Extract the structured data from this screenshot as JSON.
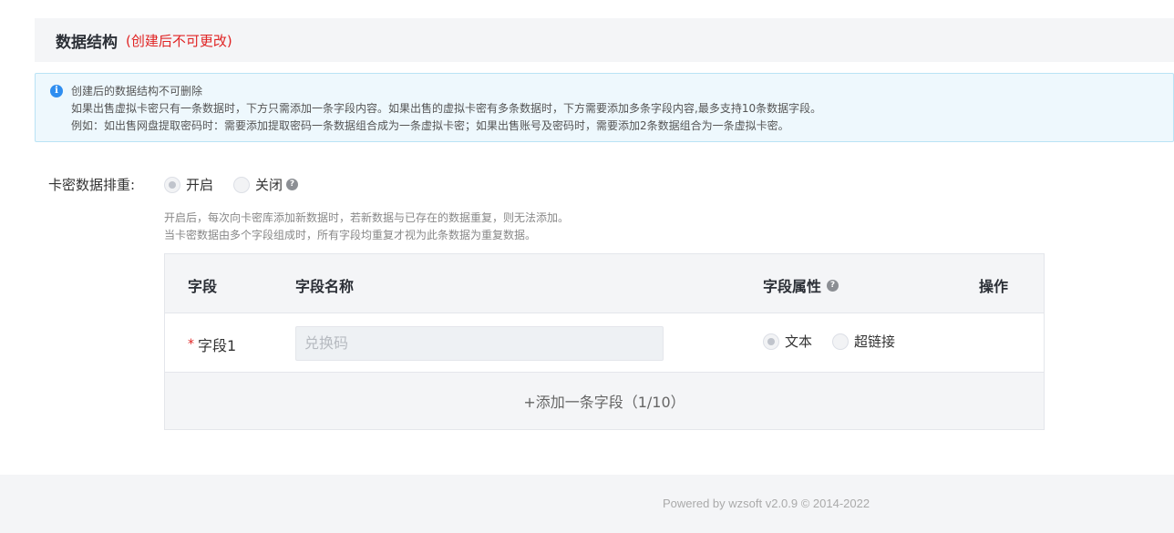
{
  "section": {
    "title": "数据结构",
    "note": "(创建后不可更改)"
  },
  "alert": {
    "icon": "info-icon",
    "line1": "创建后的数据结构不可删除",
    "line2": "如果出售虚拟卡密只有一条数据时，下方只需添加一条字段内容。如果出售的虚拟卡密有多条数据时，下方需要添加多条字段内容,最多支持10条数据字段。",
    "line3": "例如：如出售网盘提取密码时：需要添加提取密码一条数据组合成为一条虚拟卡密；如果出售账号及密码时，需要添加2条数据组合为一条虚拟卡密。"
  },
  "dedup": {
    "label": "卡密数据排重:",
    "options": [
      {
        "label": "开启",
        "selected": true
      },
      {
        "label": "关闭",
        "selected": false
      }
    ],
    "hint1": "开启后，每次向卡密库添加新数据时，若新数据与已存在的数据重复，则无法添加。",
    "hint2": "当卡密数据由多个字段组成时，所有字段均重复才视为此条数据为重复数据。"
  },
  "table": {
    "headers": {
      "field": "字段",
      "field_name": "字段名称",
      "field_attr": "字段属性",
      "action": "操作"
    },
    "rows": [
      {
        "required_mark": "*",
        "field": "字段1",
        "name_placeholder": "兑换码",
        "attr_options": [
          {
            "label": "文本",
            "selected": true
          },
          {
            "label": "超链接",
            "selected": false
          }
        ]
      }
    ],
    "add_label": "+添加一条字段（1/10）"
  },
  "footer": {
    "text": "Powered by wzsoft v2.0.9 © 2014-2022"
  }
}
